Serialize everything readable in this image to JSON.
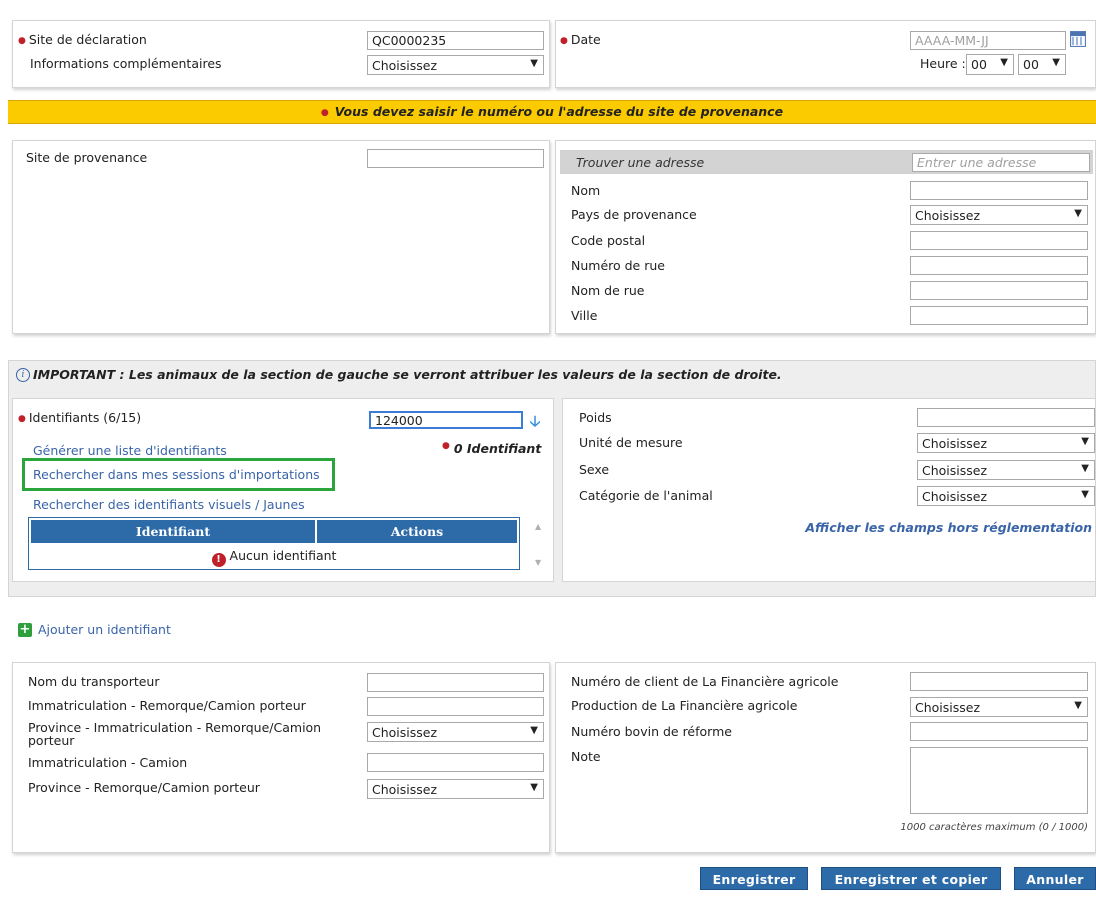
{
  "declaration": {
    "site_label": "Site de déclaration",
    "site_value": "QC0000235",
    "info_label": "Informations complémentaires",
    "info_value": "Choisissez",
    "date_label": "Date",
    "date_placeholder": "AAAA-MM-JJ",
    "heure_label": "Heure :",
    "hour_value": "00",
    "minute_value": "00"
  },
  "warning_banner": "Vous devez saisir le numéro ou l'adresse du site de provenance",
  "provenance": {
    "site_label": "Site de provenance",
    "site_value": "",
    "find_label": "Trouver une adresse",
    "find_placeholder": "Entrer une adresse",
    "nom_label": "Nom",
    "pays_label": "Pays de provenance",
    "pays_value": "Choisissez",
    "code_postal_label": "Code postal",
    "numero_rue_label": "Numéro de rue",
    "nom_rue_label": "Nom de rue",
    "ville_label": "Ville"
  },
  "important_note": "IMPORTANT : Les animaux de la section de gauche se verront attribuer les valeurs de la section de droite.",
  "identifiants": {
    "label": "Identifiants (6/15)",
    "input_value": "124000",
    "count_text": "0 Identifiant",
    "link_generate": "Générer une liste d'identifiants",
    "link_search_sessions": "Rechercher dans mes sessions d'importations",
    "link_search_visual": "Rechercher des identifiants visuels / Jaunes",
    "table_headers": [
      "Identifiant",
      "Actions"
    ],
    "empty_text": "Aucun identifiant"
  },
  "attributes": {
    "poids_label": "Poids",
    "unite_label": "Unité de mesure",
    "unite_value": "Choisissez",
    "sexe_label": "Sexe",
    "sexe_value": "Choisissez",
    "categorie_label": "Catégorie de l'animal",
    "categorie_value": "Choisissez",
    "show_fields_link": "Afficher les champs hors réglementation"
  },
  "add_identifiant": "Ajouter un identifiant",
  "transport": {
    "transporteur_label": "Nom du transporteur",
    "immat_remorque_label": "Immatriculation - Remorque/Camion porteur",
    "province_immat_label_1": "Province - Immatriculation - Remorque/Camion",
    "province_immat_label_2": "porteur",
    "province_immat_value": "Choisissez",
    "immat_camion_label": "Immatriculation - Camion",
    "province_remorque_label": "Province - Remorque/Camion porteur",
    "province_remorque_value": "Choisissez"
  },
  "financiere": {
    "client_label": "Numéro de client de La Financière agricole",
    "production_label": "Production de La Financière agricole",
    "production_value": "Choisissez",
    "bovin_label": "Numéro bovin de réforme",
    "note_label": "Note",
    "char_limit": "1000 caractères maximum (0 / 1000)"
  },
  "buttons": {
    "save": "Enregistrer",
    "save_copy": "Enregistrer et copier",
    "cancel": "Annuler"
  },
  "colors": {
    "banner": "#fbcb00",
    "primary": "#2d6ba8",
    "required": "#c0202a",
    "highlight": "#2aa53c"
  }
}
